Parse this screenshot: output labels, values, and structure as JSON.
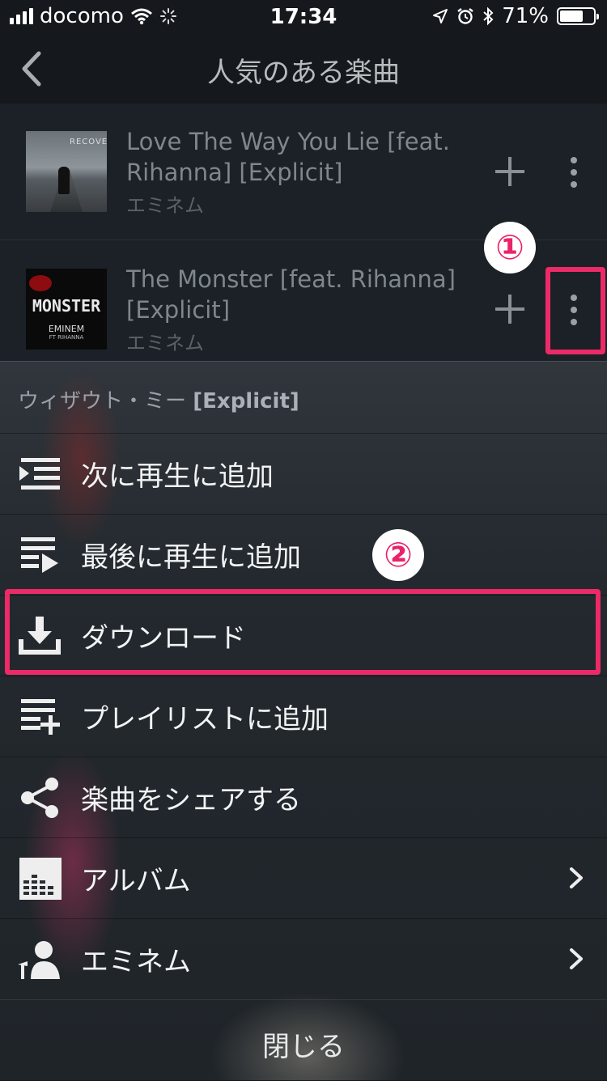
{
  "status_bar": {
    "carrier": "docomo",
    "time": "17:34",
    "battery_percent": "71%",
    "battery_level": 0.71
  },
  "nav": {
    "title": "人気のある楽曲"
  },
  "songs": [
    {
      "title": "Love The Way You Lie [feat. Rihanna] [Explicit]",
      "artist": "エミネム",
      "cover_text": "RECOVERY"
    },
    {
      "title": "The Monster [feat. Rihanna] [Explicit]",
      "artist": "エミネム",
      "cover_text": "MONSTER",
      "cover_sub": "EMINEM",
      "cover_sub2": "FT RIHANNA"
    }
  ],
  "annotations": {
    "step1": "①",
    "step2": "②",
    "color": "#ec2a68"
  },
  "sheet": {
    "header_title": "ウィザウト・ミー",
    "header_tag": "[Explicit]",
    "items": [
      {
        "label": "次に再生に追加",
        "icon": "play-next-icon"
      },
      {
        "label": "最後に再生に追加",
        "icon": "play-last-icon"
      },
      {
        "label": "ダウンロード",
        "icon": "download-icon"
      },
      {
        "label": "プレイリストに追加",
        "icon": "add-to-playlist-icon"
      },
      {
        "label": "楽曲をシェアする",
        "icon": "share-icon"
      },
      {
        "label": "アルバム",
        "icon": "album-icon"
      },
      {
        "label": "エミネム",
        "icon": "artist-icon"
      }
    ],
    "close_label": "閉じる"
  }
}
